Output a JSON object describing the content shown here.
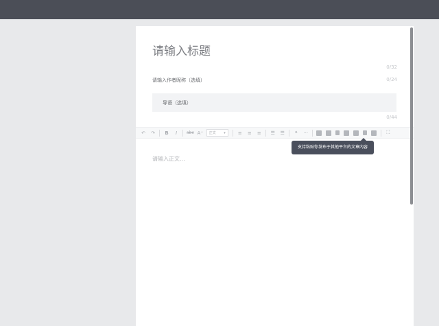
{
  "editor": {
    "title_placeholder": "请输入标题",
    "title_count": "0/32",
    "author_placeholder": "请输入作者昵称（选填）",
    "author_count": "0/24",
    "summary_placeholder": "导语（选填）",
    "summary_count": "0/44",
    "body_placeholder": "请输入正文..."
  },
  "toolbar": {
    "undo": "↶",
    "redo": "↷",
    "bold": "B",
    "italic": "I",
    "strike": "abc",
    "font_size": "A⁺",
    "paragraph_select": "正文",
    "quote": "❝",
    "more": "···"
  },
  "tooltip": {
    "text": "支持粘贴你发布于其他平台的文章内容"
  },
  "colors": {
    "topbar": "#4b4e57",
    "background": "#e8e9eb",
    "tooltip": "#4a4f5c"
  }
}
